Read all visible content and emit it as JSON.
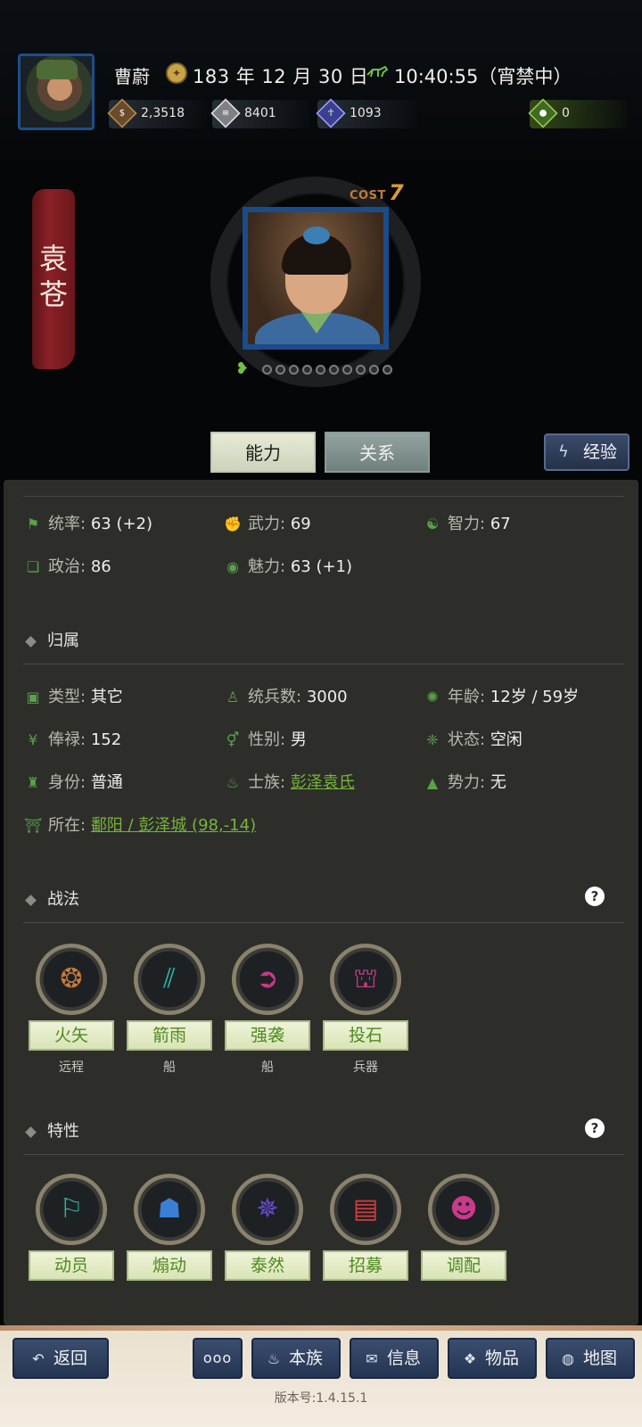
{
  "header": {
    "player_name": "曹蔚",
    "date": "183 年 12 月 30 日",
    "time": "10:40:55（宵禁中）",
    "resources": [
      {
        "icon": "coin-bag-icon",
        "value": "2,3518"
      },
      {
        "icon": "grain-icon",
        "value": "8401"
      },
      {
        "icon": "soldier-icon",
        "value": "1093"
      },
      {
        "icon": "green-pouch-icon",
        "value": "0"
      }
    ]
  },
  "character": {
    "name_vertical": "袁苍",
    "cost_label": "COST",
    "cost_value": "7",
    "loyalty_dots_total": 10,
    "loyalty_dots_filled": 0
  },
  "tabs": {
    "ability": "能力",
    "relation": "关系",
    "experience": "经验"
  },
  "stats": {
    "row1": [
      {
        "icon": "flag-icon",
        "label": "统率:",
        "value": "63 (+2)"
      },
      {
        "icon": "fist-icon",
        "label": "武力:",
        "value": "69"
      },
      {
        "icon": "brain-icon",
        "label": "智力:",
        "value": "67"
      }
    ],
    "row2": [
      {
        "icon": "scroll-icon",
        "label": "政治:",
        "value": "86"
      },
      {
        "icon": "eye-icon",
        "label": "魅力:",
        "value": "63 (+1)"
      }
    ]
  },
  "affiliation": {
    "title": "归属",
    "row1": [
      {
        "icon": "calendar-icon",
        "label": "类型:",
        "value": "其它"
      },
      {
        "icon": "person-icon",
        "label": "统兵数:",
        "value": "3000"
      },
      {
        "icon": "age-icon",
        "label": "年龄:",
        "value": "12岁 / 59岁"
      }
    ],
    "row2": [
      {
        "icon": "yen-icon",
        "label": "俸禄:",
        "value": "152"
      },
      {
        "icon": "gender-icon",
        "label": "性别:",
        "value": "男"
      },
      {
        "icon": "status-icon",
        "label": "状态:",
        "value": "空闲"
      }
    ],
    "row3": [
      {
        "icon": "id-icon",
        "label": "身份:",
        "value": "普通"
      },
      {
        "icon": "clan-icon",
        "label": "士族:",
        "value": "彭泽袁氏"
      },
      {
        "icon": "mountain-icon",
        "label": "势力:",
        "value": "无"
      }
    ],
    "location": {
      "icon": "building-icon",
      "label": "所在:",
      "value": "鄱阳 / 彭泽城 (98,-14)"
    }
  },
  "tactics": {
    "title": "战法",
    "help": "?",
    "items": [
      {
        "label": "火矢",
        "sub": "远程",
        "icon": "fire-arrow-icon",
        "color": "#c57c3a"
      },
      {
        "label": "箭雨",
        "sub": "船",
        "icon": "arrow-rain-icon",
        "color": "#2fb3a6"
      },
      {
        "label": "强袭",
        "sub": "船",
        "icon": "assault-icon",
        "color": "#c83a8a"
      },
      {
        "label": "投石",
        "sub": "兵器",
        "icon": "catapult-icon",
        "color": "#c83a8a"
      }
    ]
  },
  "traits": {
    "title": "特性",
    "help": "?",
    "items": [
      {
        "label": "动员",
        "icon": "mobilize-icon",
        "color": "#2fb3a6"
      },
      {
        "label": "煽动",
        "icon": "incite-icon",
        "color": "#3a7fd4"
      },
      {
        "label": "泰然",
        "icon": "calm-icon",
        "color": "#6a4fd0"
      },
      {
        "label": "招募",
        "icon": "recruit-icon",
        "color": "#d04040"
      },
      {
        "label": "调配",
        "icon": "allocate-icon",
        "color": "#c83a8a"
      }
    ]
  },
  "bottom_nav": {
    "back": "返回",
    "more": "ooo",
    "clan": "本族",
    "info": "信息",
    "items": "物品",
    "map": "地图"
  },
  "version": "版本号:1.4.15.1"
}
